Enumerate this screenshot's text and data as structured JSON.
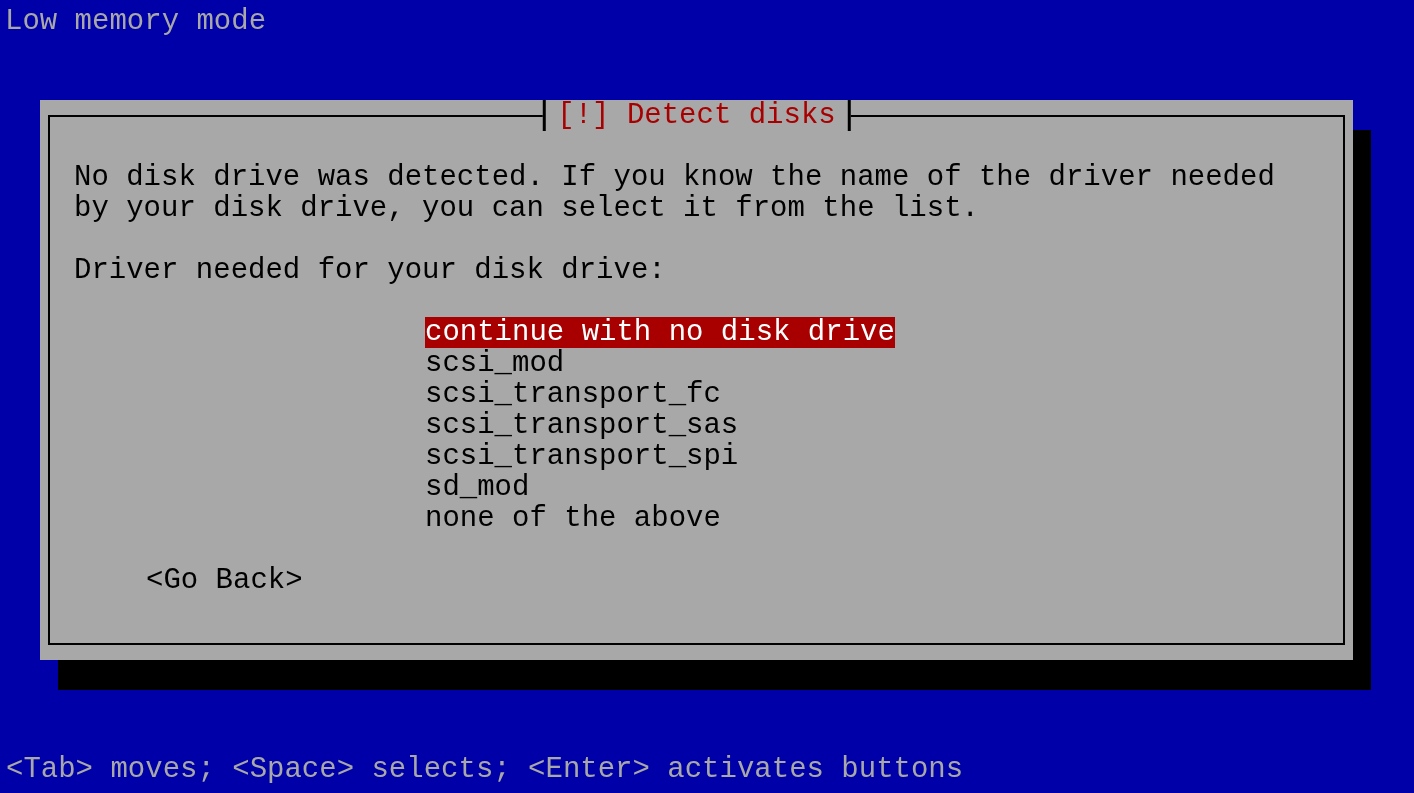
{
  "top_title": "Low memory mode",
  "dialog": {
    "title": "[!] Detect disks",
    "message": "No disk drive was detected. If you know the name of the driver needed by your disk drive, you can select it from the list.",
    "prompt": "Driver needed for your disk drive:",
    "options": [
      {
        "label": "continue with no disk drive",
        "selected": true
      },
      {
        "label": "scsi_mod",
        "selected": false
      },
      {
        "label": "scsi_transport_fc",
        "selected": false
      },
      {
        "label": "scsi_transport_sas",
        "selected": false
      },
      {
        "label": "scsi_transport_spi",
        "selected": false
      },
      {
        "label": "sd_mod",
        "selected": false
      },
      {
        "label": "none of the above",
        "selected": false
      }
    ],
    "buttons": [
      {
        "label": "<Go Back>"
      }
    ]
  },
  "help_line": "<Tab> moves; <Space> selects; <Enter> activates buttons"
}
